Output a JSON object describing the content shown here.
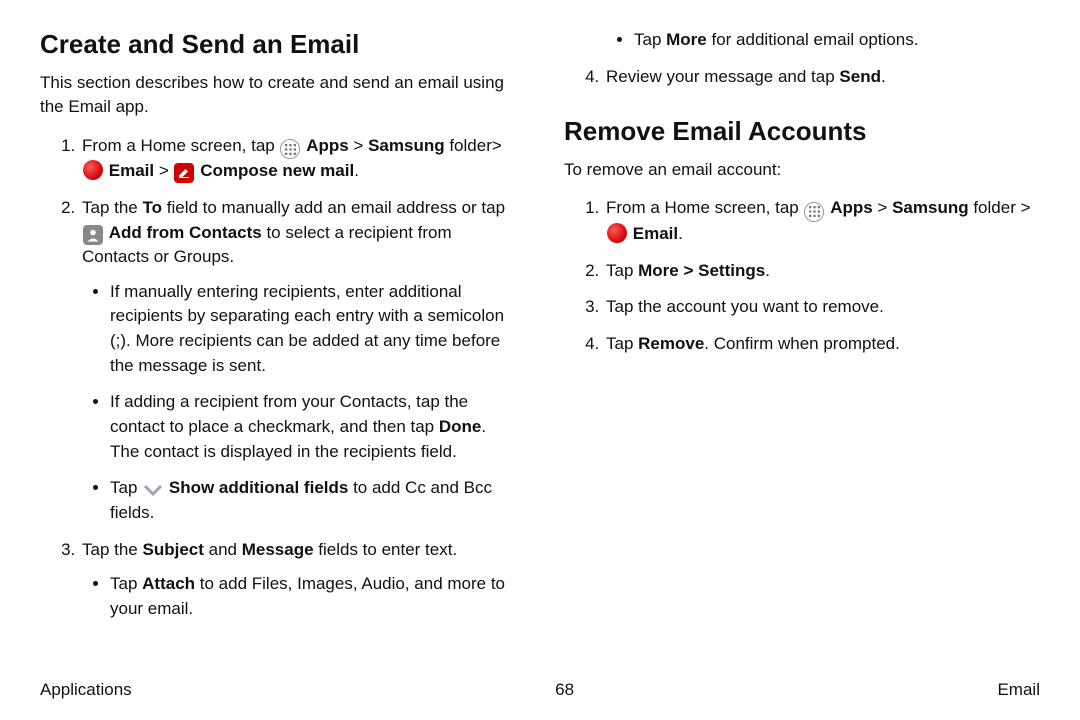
{
  "section1": {
    "heading": "Create and Send an Email",
    "intro": "This section describes how to create and send an email using the Email app.",
    "step1": {
      "a": "From a Home screen, tap ",
      "apps": "Apps",
      "sep1": " > ",
      "samsung": "Samsung",
      "folder": " folder> ",
      "email": "Email",
      "sep2": " > ",
      "compose": "Compose new mail",
      "end": "."
    },
    "step2": {
      "a": "Tap the ",
      "to": "To",
      "b": " field to manually add an email address or tap ",
      "add": "Add from Contacts",
      "c": " to select a recipient from Contacts or Groups.",
      "bullets": {
        "b1": "If manually entering recipients, enter additional recipients by separating each entry with a semicolon (;). More recipients can be added at any time before the message is sent.",
        "b2a": "If adding a recipient from your Contacts, tap the contact to place a checkmark, and then tap ",
        "b2done": "Done",
        "b2b": ". The contact is displayed in the recipients field.",
        "b3a": "Tap ",
        "b3label": "Show additional fields",
        "b3b": "  to add Cc and Bcc fields."
      }
    },
    "step3": {
      "a": "Tap the ",
      "subject": "Subject",
      "and": " and ",
      "message": "Message",
      "b": " fields to enter text.",
      "bullets": {
        "b1a": "Tap ",
        "b1attach": "Attach",
        "b1b": " to add Files, Images, Audio, and more to your email.",
        "b2a": "Tap ",
        "b2more": "More",
        "b2b": " for additional email options."
      }
    },
    "step4": {
      "a": "Review your message and tap ",
      "send": "Send",
      "b": "."
    }
  },
  "section2": {
    "heading": "Remove Email Accounts",
    "intro": "To remove an email account:",
    "step1": {
      "a": "From a Home screen, tap ",
      "apps": "Apps",
      "sep1": " > ",
      "samsung": "Samsung",
      "folder": " folder > ",
      "email": "Email",
      "end": "."
    },
    "step2": {
      "a": "Tap ",
      "more": "More",
      "sep": " > ",
      "settings": "Settings",
      "b": "."
    },
    "step3": "Tap the account you want to remove.",
    "step4": {
      "a": "Tap ",
      "remove": "Remove",
      "b": ". Confirm when prompted."
    }
  },
  "footer": {
    "left": "Applications",
    "center": "68",
    "right": "Email"
  }
}
